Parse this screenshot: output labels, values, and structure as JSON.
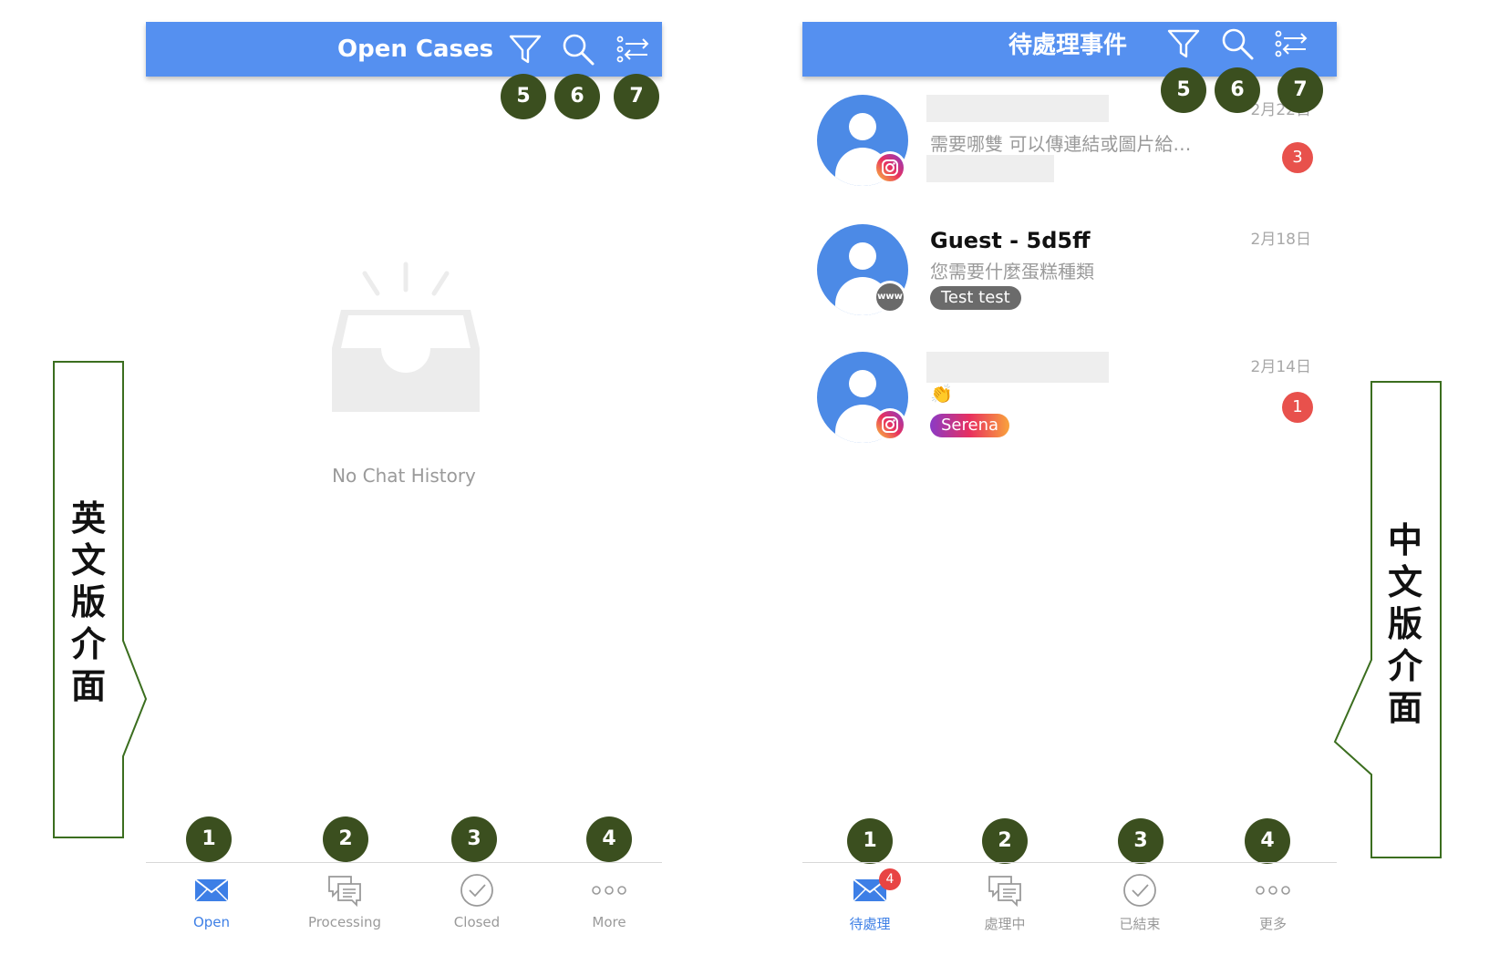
{
  "english_panel": {
    "header_title": "Open Cases",
    "header_icons": [
      "filter-icon",
      "search-icon",
      "sort-settings-icon"
    ],
    "header_callouts": [
      "5",
      "6",
      "7"
    ],
    "empty_state_label": "No Chat History",
    "tab_callouts": [
      "1",
      "2",
      "3",
      "4"
    ],
    "tabs": [
      {
        "label": "Open",
        "icon": "envelope-icon",
        "active": true
      },
      {
        "label": "Processing",
        "icon": "chat-bubbles-icon",
        "active": false
      },
      {
        "label": "Closed",
        "icon": "check-circle-icon",
        "active": false
      },
      {
        "label": "More",
        "icon": "more-dots-icon",
        "active": false
      }
    ],
    "side_label": [
      "英",
      "文",
      "版",
      "介",
      "面"
    ]
  },
  "chinese_panel": {
    "header_title": "待處理事件",
    "header_icons": [
      "filter-icon",
      "search-icon",
      "sort-settings-icon"
    ],
    "header_callouts": [
      "5",
      "6",
      "7"
    ],
    "conversations": [
      {
        "name": "",
        "message": "需要哪雙 可以傳連結或圖片給…",
        "date": "2月22日",
        "unread": "3",
        "channel": "instagram",
        "tag": ""
      },
      {
        "name": "Guest - 5d5ff",
        "message": "您需要什麼蛋糕種類",
        "date": "2月18日",
        "unread": "",
        "channel": "www",
        "channel_label": "www",
        "tag": "Test test"
      },
      {
        "name": "",
        "message": "👏",
        "date": "2月14日",
        "unread": "1",
        "channel": "instagram",
        "tag": "Serena"
      }
    ],
    "tab_callouts": [
      "1",
      "2",
      "3",
      "4"
    ],
    "tabs": [
      {
        "label": "待處理",
        "icon": "envelope-icon",
        "active": true,
        "badge": "4"
      },
      {
        "label": "處理中",
        "icon": "chat-bubbles-icon",
        "active": false
      },
      {
        "label": "已結束",
        "icon": "check-circle-icon",
        "active": false
      },
      {
        "label": "更多",
        "icon": "more-dots-icon",
        "active": false
      }
    ],
    "side_label": [
      "中",
      "文",
      "版",
      "介",
      "面"
    ]
  },
  "colors": {
    "header_blue": "#5590f0",
    "callout_green": "#3b4f1f",
    "active_tab_blue": "#3d7fe6",
    "badge_red": "#e8514c",
    "tag_gray": "#6b6b6b"
  }
}
